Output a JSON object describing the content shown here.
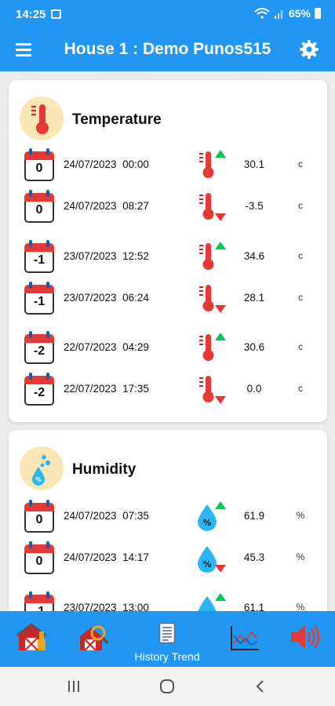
{
  "status": {
    "time": "14:25",
    "battery": "65%"
  },
  "appbar": {
    "title": "House 1 : Demo Punos515"
  },
  "temperature": {
    "title": "Temperature",
    "rows": [
      {
        "day": "0",
        "date": "24/07/2023",
        "time": "00:00",
        "trend": "up",
        "value": "30.1",
        "unit": "c"
      },
      {
        "day": "0",
        "date": "24/07/2023",
        "time": "08:27",
        "trend": "down",
        "value": "-3.5",
        "unit": "c"
      },
      {
        "day": "-1",
        "date": "23/07/2023",
        "time": "12:52",
        "trend": "up",
        "value": "34.6",
        "unit": "c"
      },
      {
        "day": "-1",
        "date": "23/07/2023",
        "time": "06:24",
        "trend": "down",
        "value": "28.1",
        "unit": "c"
      },
      {
        "day": "-2",
        "date": "22/07/2023",
        "time": "04:29",
        "trend": "up",
        "value": "30.6",
        "unit": "c"
      },
      {
        "day": "-2",
        "date": "22/07/2023",
        "time": "17:35",
        "trend": "down",
        "value": "0.0",
        "unit": "c"
      }
    ]
  },
  "humidity": {
    "title": "Humidity",
    "rows": [
      {
        "day": "0",
        "date": "24/07/2023",
        "time": "07:35",
        "trend": "up",
        "value": "61.9",
        "unit": "%"
      },
      {
        "day": "0",
        "date": "24/07/2023",
        "time": "14:17",
        "trend": "down",
        "value": "45.3",
        "unit": "%"
      },
      {
        "day": "-1",
        "date": "23/07/2023",
        "time": "13:00",
        "trend": "up",
        "value": "61.1",
        "unit": "%"
      }
    ]
  },
  "bottom_nav": {
    "items": [
      {
        "icon": "barn-icon"
      },
      {
        "icon": "barn-search-icon"
      },
      {
        "icon": "document-icon",
        "label": "History Trend"
      },
      {
        "icon": "line-chart-icon"
      },
      {
        "icon": "speaker-icon"
      }
    ]
  },
  "colors": {
    "primary": "#2196F3",
    "red": "#E53935",
    "green": "#00C853",
    "cyan": "#29B6F6",
    "header_circle": "#FBE7B5"
  }
}
